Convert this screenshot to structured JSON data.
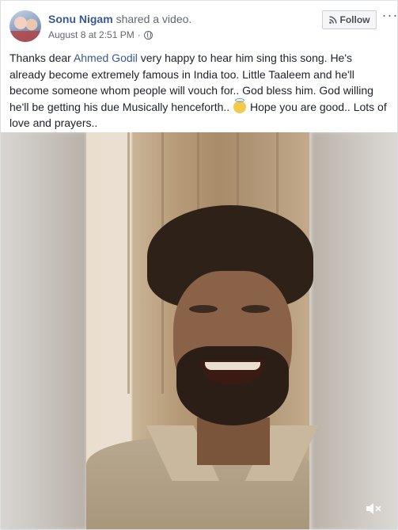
{
  "post": {
    "author_name": "Sonu Nigam",
    "action_text": "shared a video.",
    "timestamp": "August 8 at 2:51 PM",
    "separator": "·",
    "privacy_icon": "globe-icon",
    "follow_label": "Follow",
    "follow_icon": "rss-icon",
    "more_label": "···",
    "text_before_mention": "Thanks dear ",
    "mention": "Ahmed Godil",
    "text_after_mention": " very happy to hear him sing this song. He's already become extremely famous in India too. Little Taaleem and he'll become someone whom people will vouch for.. God bless him. God willing he'll be getting his due Musically henceforth.. ",
    "emoji": "smiling-face-with-halo",
    "text_after_emoji": " Hope you are good.. Lots of love and prayers.."
  },
  "video": {
    "mute_icon": "speaker-muted-icon"
  },
  "colors": {
    "link": "#385898",
    "text": "#1d2129",
    "meta": "#606770",
    "background": "#e9ebee"
  }
}
